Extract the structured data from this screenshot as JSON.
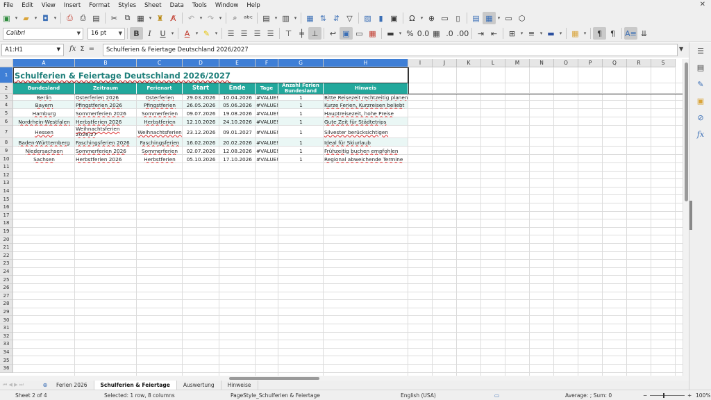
{
  "menu": [
    "File",
    "Edit",
    "View",
    "Insert",
    "Format",
    "Styles",
    "Sheet",
    "Data",
    "Tools",
    "Window",
    "Help"
  ],
  "toolbar": {
    "font_name": "Calibri",
    "font_size": "16 pt"
  },
  "formula_bar": {
    "cell_ref": "A1:H1",
    "fx": "fx",
    "sum": "Σ",
    "equals": "=",
    "content": "Schulferien & Feiertage Deutschland 2026/2027"
  },
  "columns": [
    "A",
    "B",
    "C",
    "D",
    "E",
    "F",
    "G",
    "H",
    "I",
    "J",
    "K",
    "L",
    "M",
    "N",
    "O",
    "P",
    "Q",
    "R",
    "S"
  ],
  "rows": [
    "1",
    "2",
    "3",
    "4",
    "5",
    "6",
    "7",
    "8",
    "9",
    "10",
    "11",
    "12",
    "13",
    "14",
    "15",
    "16",
    "17",
    "18",
    "19",
    "20",
    "21",
    "22",
    "23",
    "24",
    "25",
    "26",
    "27",
    "28",
    "29",
    "30",
    "31",
    "32",
    "33",
    "34",
    "35",
    "36"
  ],
  "sheet": {
    "title": "Schulferien & Feiertage Deutschland 2026/2027",
    "headers": [
      "Bundesland",
      "Zeitraum",
      "Ferienart",
      "Start",
      "Ende",
      "Tage",
      "Anzahl Ferien Bundesland",
      "Hinweis"
    ],
    "data": [
      [
        "Berlin",
        "Osterferien 2026",
        "Osterferien",
        "29.03.2026",
        "10.04.2026",
        "#VALUE!",
        "1",
        "Bitte Reisezeit rechtzeitig planen"
      ],
      [
        "Bayern",
        "Pfingstferien 2026",
        "Pfingstferien",
        "26.05.2026",
        "05.06.2026",
        "#VALUE!",
        "1",
        "Kurze Ferien, Kurzreisen beliebt"
      ],
      [
        "Hamburg",
        "Sommerferien 2026",
        "Sommerferien",
        "09.07.2026",
        "19.08.2026",
        "#VALUE!",
        "1",
        "Hauptreisezeit, hohe Preise"
      ],
      [
        "Nordrhein-Westfalen",
        "Herbstferien 2026",
        "Herbstferien",
        "12.10.2026",
        "24.10.2026",
        "#VALUE!",
        "1",
        "Gute Zeit für Städtetrips"
      ],
      [
        "Hessen",
        "Weihnachtsferien 2026/27",
        "Weihnachtsferien",
        "23.12.2026",
        "09.01.2027",
        "#VALUE!",
        "1",
        "Silvester berücksichtigen"
      ],
      [
        "Baden-Württemberg",
        "Faschingsferien 2026",
        "Faschingsferien",
        "16.02.2026",
        "20.02.2026",
        "#VALUE!",
        "1",
        "Ideal für Skiurlaub"
      ],
      [
        "Niedersachsen",
        "Sommerferien 2026",
        "Sommerferien",
        "02.07.2026",
        "12.08.2026",
        "#VALUE!",
        "1",
        "Frühzeitig buchen empfohlen"
      ],
      [
        "Sachsen",
        "Herbstferien 2026",
        "Herbstferien",
        "05.10.2026",
        "17.10.2026",
        "#VALUE!",
        "1",
        "Regional abweichende Termine"
      ]
    ]
  },
  "tabs": [
    "Ferien 2026",
    "Schulferien & Feiertage",
    "Auswertung",
    "Hinweise"
  ],
  "active_tab": "Schulferien & Feiertage",
  "status": {
    "sheet_pos": "Sheet 2 of 4",
    "selection": "Selected: 1 row, 8 columns",
    "page_style": "PageStyle_Schulferien & Feiertage",
    "language": "English (USA)",
    "summary": "Average: ; Sum: 0",
    "zoom": "100%"
  },
  "colors": {
    "header_teal": "#22a89c",
    "title_teal": "#1e7f7a",
    "selection_blue": "#3f7fd6",
    "alt_row": "#eaf7f5"
  }
}
